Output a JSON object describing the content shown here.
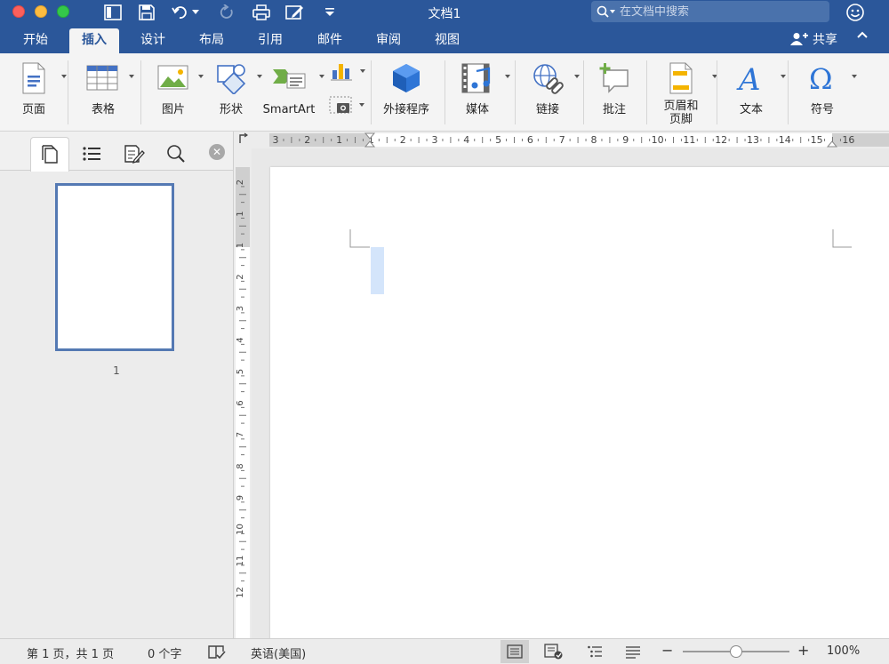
{
  "window": {
    "title": "文档1"
  },
  "search": {
    "placeholder": "在文档中搜索"
  },
  "tabs": [
    {
      "label": "开始"
    },
    {
      "label": "插入"
    },
    {
      "label": "设计"
    },
    {
      "label": "布局"
    },
    {
      "label": "引用"
    },
    {
      "label": "邮件"
    },
    {
      "label": "审阅"
    },
    {
      "label": "视图"
    }
  ],
  "active_tab": "插入",
  "share": {
    "label": "共享"
  },
  "ribbon": {
    "pages": "页面",
    "table": "表格",
    "pictures": "图片",
    "shapes": "形状",
    "smartart": "SmartArt",
    "addins": "外接程序",
    "media": "媒体",
    "link": "链接",
    "comment": "批注",
    "header_footer_line1": "页眉和",
    "header_footer_line2": "页脚",
    "text": "文本",
    "symbol": "符号"
  },
  "sidepane": {
    "page_number": "1"
  },
  "ruler": {
    "h_ticks": [
      "3",
      "2",
      "1",
      "1",
      "2",
      "3",
      "4",
      "5",
      "6",
      "7",
      "8",
      "9",
      "10",
      "11",
      "12",
      "13",
      "14",
      "15",
      "16"
    ],
    "v_ticks": [
      "2",
      "1",
      "1",
      "2",
      "3",
      "4",
      "5",
      "6",
      "7",
      "8",
      "9",
      "10",
      "11",
      "12"
    ]
  },
  "status": {
    "page": "第 1 页，共 1 页",
    "words": "0 个字",
    "language": "英语(美国)",
    "zoom": "100%",
    "zoom_level": 0.5
  },
  "colors": {
    "brand": "#2b579a",
    "accent": "#4472c4"
  }
}
